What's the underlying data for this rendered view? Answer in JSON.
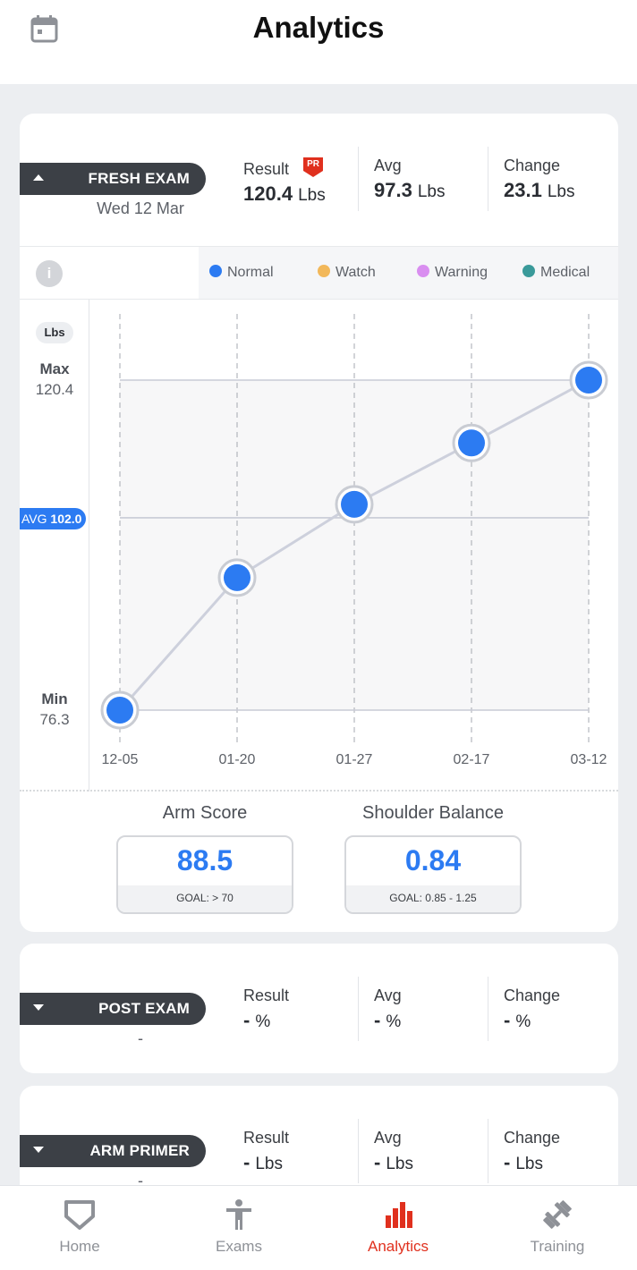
{
  "header": {
    "title": "Analytics",
    "calendar_icon": "calendar-icon"
  },
  "colors": {
    "accent": "#2c7bf2",
    "active_tab": "#e0301e",
    "normal": "#2c7bf2",
    "watch": "#f2b85a",
    "warning": "#d98ef0",
    "medical": "#3a9a9a",
    "pr_badge": "#e0301e"
  },
  "fresh_exam": {
    "label": "FRESH EXAM",
    "date": "Wed 12 Mar",
    "result_title": "Result",
    "pr_badge": "PR",
    "result_value": "120.4",
    "result_unit": "Lbs",
    "avg_title": "Avg",
    "avg_value": "97.3",
    "avg_unit": "Lbs",
    "change_title": "Change",
    "change_value": "23.1",
    "change_unit": "Lbs"
  },
  "legend": {
    "info": "i",
    "items": [
      {
        "label": "Normal",
        "color": "#2c7bf2"
      },
      {
        "label": "Watch",
        "color": "#f2b85a"
      },
      {
        "label": "Warning",
        "color": "#d98ef0"
      },
      {
        "label": "Medical",
        "color": "#3a9a9a"
      }
    ]
  },
  "yaxis": {
    "unit": "Lbs",
    "max_label": "Max",
    "max_value": "120.4",
    "avg_label": "AVG",
    "avg_value": "102.0",
    "min_label": "Min",
    "min_value": "76.3"
  },
  "chart_data": {
    "type": "line",
    "x": [
      "12-05",
      "01-20",
      "01-27",
      "02-17",
      "03-12"
    ],
    "series": [
      {
        "values": [
          76.3,
          94.0,
          103.8,
          112.0,
          120.4
        ]
      }
    ],
    "ylim": [
      76.3,
      120.4
    ],
    "avg_line": 102.0,
    "grid": true
  },
  "metrics": {
    "arm_score_title": "Arm Score",
    "arm_score_value": "88.5",
    "arm_score_goal": "GOAL: > 70",
    "shoulder_title": "Shoulder Balance",
    "shoulder_value": "0.84",
    "shoulder_goal": "GOAL: 0.85 - 1.25"
  },
  "post_exam": {
    "label": "POST EXAM",
    "date": "-",
    "result_title": "Result",
    "result_value": "-",
    "result_unit": "%",
    "avg_title": "Avg",
    "avg_value": "-",
    "avg_unit": "%",
    "change_title": "Change",
    "change_value": "-",
    "change_unit": "%"
  },
  "arm_primer": {
    "label": "ARM PRIMER",
    "date": "-",
    "result_title": "Result",
    "result_value": "-",
    "result_unit": "Lbs",
    "avg_title": "Avg",
    "avg_value": "-",
    "avg_unit": "Lbs",
    "change_title": "Change",
    "change_value": "-",
    "change_unit": "Lbs"
  },
  "tabs": [
    {
      "label": "Home",
      "icon": "home-plate-icon",
      "active": false
    },
    {
      "label": "Exams",
      "icon": "person-icon",
      "active": false
    },
    {
      "label": "Analytics",
      "icon": "bar-chart-icon",
      "active": true
    },
    {
      "label": "Training",
      "icon": "dumbbell-icon",
      "active": false
    }
  ]
}
